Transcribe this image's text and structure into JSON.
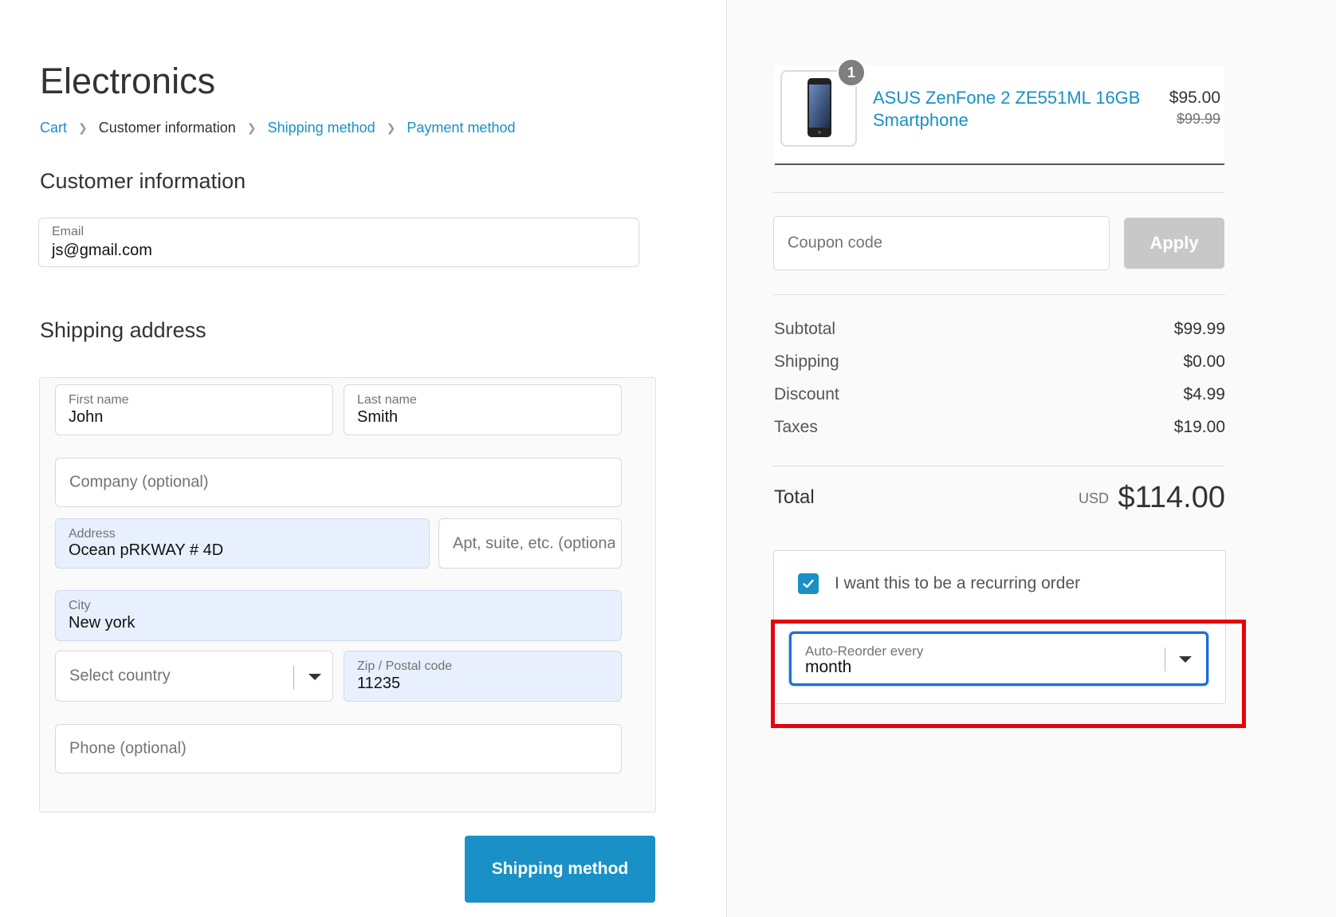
{
  "store": {
    "title": "Electronics"
  },
  "breadcrumb": {
    "cart": "Cart",
    "customer_information": "Customer information",
    "shipping_method": "Shipping method",
    "payment_method": "Payment method"
  },
  "customer_section": {
    "title": "Customer information",
    "email_label": "Email",
    "email_value": "js@gmail.com"
  },
  "shipping_section": {
    "title": "Shipping address",
    "first_name_label": "First name",
    "first_name_value": "John",
    "last_name_label": "Last name",
    "last_name_value": "Smith",
    "company_placeholder": "Company (optional)",
    "address_label": "Address",
    "address_value": "Ocean pRKWAY # 4D",
    "apt_placeholder": "Apt, suite, etc. (optional)",
    "city_label": "City",
    "city_value": "New york",
    "country_placeholder": "Select country",
    "zip_label": "Zip / Postal code",
    "zip_value": "11235",
    "phone_placeholder": "Phone (optional)",
    "continue_button": "Shipping method"
  },
  "order": {
    "quantity": "1",
    "product_name": "ASUS ZenFone 2 ZE551ML 16GB Smartphone",
    "price": "$95.00",
    "original_price": "$99.99",
    "coupon_placeholder": "Coupon code",
    "apply_button": "Apply",
    "summary": {
      "subtotal_label": "Subtotal",
      "subtotal_value": "$99.99",
      "shipping_label": "Shipping",
      "shipping_value": "$0.00",
      "discount_label": "Discount",
      "discount_value": "$4.99",
      "taxes_label": "Taxes",
      "taxes_value": "$19.00"
    },
    "total_label": "Total",
    "total_currency": "USD",
    "total_value": "$114.00"
  },
  "recurring": {
    "checked": true,
    "label": "I want this to be a recurring order",
    "reorder_label": "Auto-Reorder every",
    "reorder_value": "month"
  },
  "colors": {
    "accent": "#1990c6",
    "highlight": "#e8000b",
    "autofill": "#e8f0fe"
  },
  "icons": [
    "chevron-right-icon",
    "caret-down-icon",
    "checkmark-icon",
    "phone-product-image"
  ]
}
